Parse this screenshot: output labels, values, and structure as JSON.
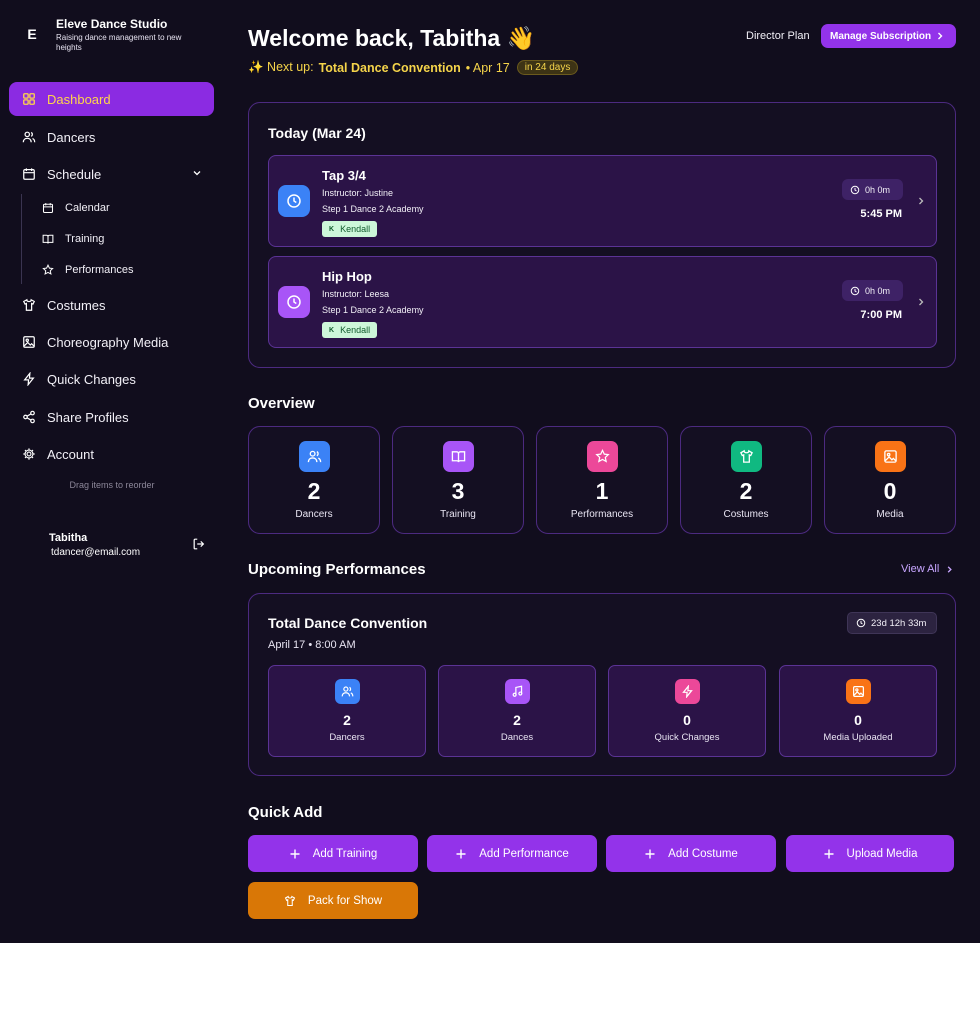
{
  "brand": {
    "logo": "E",
    "name": "Eleve Dance Studio",
    "tagline": "Raising dance management to new heights"
  },
  "nav": {
    "dashboard": "Dashboard",
    "dancers": "Dancers",
    "schedule": "Schedule",
    "calendar": "Calendar",
    "training": "Training",
    "performances": "Performances",
    "costumes": "Costumes",
    "choreography": "Choreography Media",
    "quick_changes": "Quick Changes",
    "share_profiles": "Share Profiles",
    "account": "Account",
    "drag_hint": "Drag items to reorder"
  },
  "user": {
    "name": "Tabitha",
    "email": "tdancer@email.com"
  },
  "header": {
    "welcome": "Welcome back, Tabitha 👋",
    "next_up_prefix": "✨ Next up:",
    "next_up_event": "Total Dance Convention",
    "next_up_date": "• Apr 17",
    "next_up_badge": "in 24 days",
    "plan": "Director Plan",
    "manage_label": "Manage Subscription"
  },
  "today": {
    "title": "Today (Mar 24)",
    "classes": [
      {
        "name": "Tap 3/4",
        "instructor": "Instructor: Justine",
        "location": "Step 1 Dance 2 Academy",
        "dancer_initial": "K",
        "dancer": "Kendall",
        "duration": "0h 0m",
        "time": "5:45 PM",
        "icon_color": "#3b82f6"
      },
      {
        "name": "Hip Hop",
        "instructor": "Instructor: Leesa",
        "location": "Step 1 Dance 2 Academy",
        "dancer_initial": "K",
        "dancer": "Kendall",
        "duration": "0h 0m",
        "time": "7:00 PM",
        "icon_color": "#a855f7"
      }
    ]
  },
  "overview": {
    "title": "Overview",
    "cards": [
      {
        "value": "2",
        "label": "Dancers",
        "icon": "users-icon",
        "color": "#3b82f6"
      },
      {
        "value": "3",
        "label": "Training",
        "icon": "book-icon",
        "color": "#a855f7"
      },
      {
        "value": "1",
        "label": "Performances",
        "icon": "star-icon",
        "color": "#ec4899"
      },
      {
        "value": "2",
        "label": "Costumes",
        "icon": "shirt-icon",
        "color": "#10b981"
      },
      {
        "value": "0",
        "label": "Media",
        "icon": "image-icon",
        "color": "#f97316"
      }
    ]
  },
  "upcoming": {
    "title": "Upcoming Performances",
    "view_all": "View All",
    "event": {
      "name": "Total Dance Convention",
      "date": "April 17 • 8:00 AM",
      "countdown": "23d 12h 33m",
      "stats": [
        {
          "value": "2",
          "label": "Dancers",
          "icon": "users-icon",
          "color": "#3b82f6"
        },
        {
          "value": "2",
          "label": "Dances",
          "icon": "music-icon",
          "color": "#a855f7"
        },
        {
          "value": "0",
          "label": "Quick Changes",
          "icon": "bolt-icon",
          "color": "#ec4899"
        },
        {
          "value": "0",
          "label": "Media Uploaded",
          "icon": "image-icon",
          "color": "#f97316"
        }
      ]
    }
  },
  "quick_add": {
    "title": "Quick Add",
    "add_training": "Add Training",
    "add_performance": "Add Performance",
    "add_costume": "Add Costume",
    "upload_media": "Upload Media",
    "pack_for_show": "Pack for Show"
  }
}
